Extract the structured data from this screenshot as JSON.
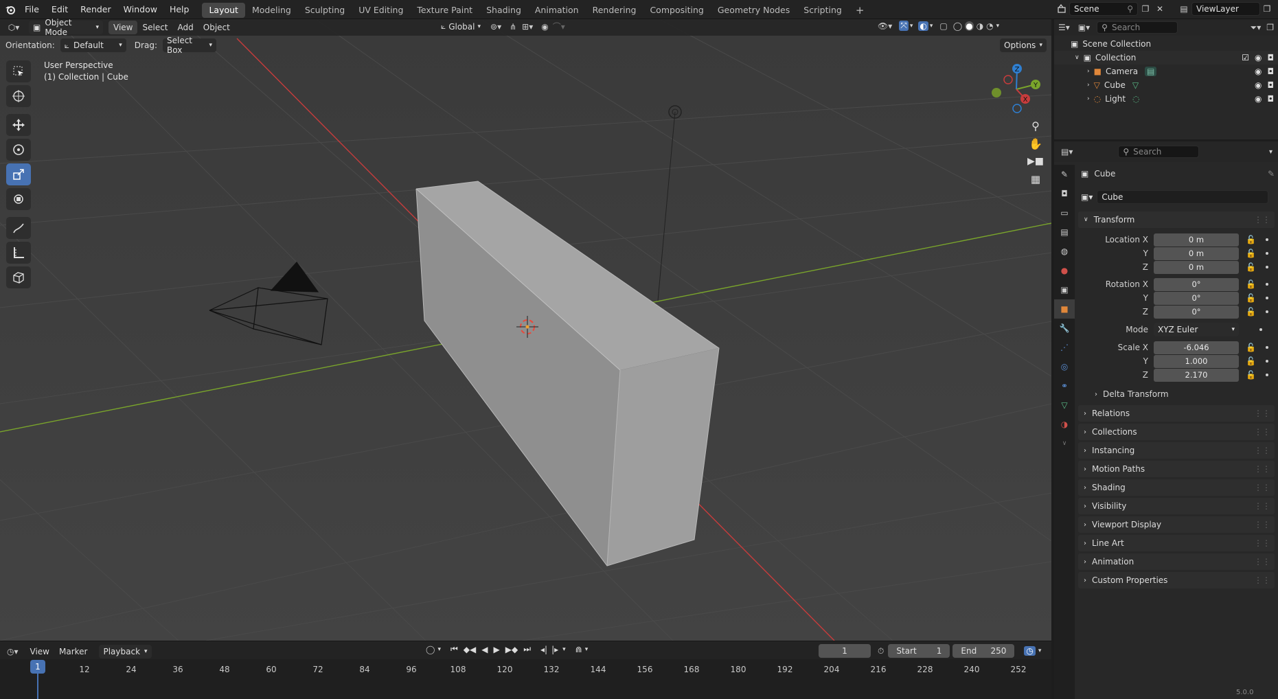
{
  "topbar": {
    "menus": [
      "File",
      "Edit",
      "Render",
      "Window",
      "Help"
    ],
    "workspaces": [
      "Layout",
      "Modeling",
      "Sculpting",
      "UV Editing",
      "Texture Paint",
      "Shading",
      "Animation",
      "Rendering",
      "Compositing",
      "Geometry Nodes",
      "Scripting"
    ],
    "active_workspace": "Layout",
    "scene": "Scene",
    "view_layer": "ViewLayer"
  },
  "viewport_header": {
    "mode": "Object Mode",
    "menus": [
      "View",
      "Select",
      "Add",
      "Object"
    ],
    "transform_orientation": "Global",
    "orientation_label": "Orientation:",
    "orientation_value": "Default",
    "drag_label": "Drag:",
    "drag_value": "Select Box",
    "options_label": "Options"
  },
  "viewport": {
    "perspective_label": "User Perspective",
    "context_label": "(1) Collection | Cube",
    "gizmo_axes": [
      "Z",
      "Y",
      "X"
    ]
  },
  "outliner": {
    "search_placeholder": "Search",
    "scene_collection": "Scene Collection",
    "collection": "Collection",
    "objects": [
      {
        "name": "Camera",
        "icon": "camera-icon"
      },
      {
        "name": "Cube",
        "icon": "mesh-icon"
      },
      {
        "name": "Light",
        "icon": "light-icon"
      }
    ]
  },
  "properties": {
    "search_placeholder": "Search",
    "object_name_header": "Cube",
    "object_name_field": "Cube",
    "transform": {
      "title": "Transform",
      "location_label": "Location X",
      "location": [
        "0 m",
        "0 m",
        "0 m"
      ],
      "rotation_label": "Rotation X",
      "rotation": [
        "0°",
        "0°",
        "0°"
      ],
      "mode_label": "Mode",
      "mode_value": "XYZ Euler",
      "scale_label": "Scale X",
      "scale": [
        "-6.046",
        "1.000",
        "2.170"
      ],
      "y_label": "Y",
      "z_label": "Z",
      "delta": "Delta Transform"
    },
    "panels": [
      "Relations",
      "Collections",
      "Instancing",
      "Motion Paths",
      "Shading",
      "Visibility",
      "Viewport Display",
      "Line Art",
      "Animation",
      "Custom Properties"
    ]
  },
  "timeline": {
    "menus": [
      "View",
      "Marker"
    ],
    "playback_label": "Playback",
    "current_frame": "1",
    "start_label": "Start",
    "start_value": "1",
    "end_label": "End",
    "end_value": "250",
    "ruler": [
      "1",
      "12",
      "24",
      "36",
      "48",
      "60",
      "72",
      "84",
      "96",
      "108",
      "120",
      "132",
      "144",
      "156",
      "168",
      "180",
      "192",
      "204",
      "216",
      "228",
      "240",
      "252"
    ]
  },
  "statusbar": {
    "version": "5.0.0"
  },
  "colors": {
    "accent": "#4772b3",
    "x_axis": "#c83c3c",
    "y_axis": "#7aa52b",
    "z_axis": "#2f7fd1"
  }
}
